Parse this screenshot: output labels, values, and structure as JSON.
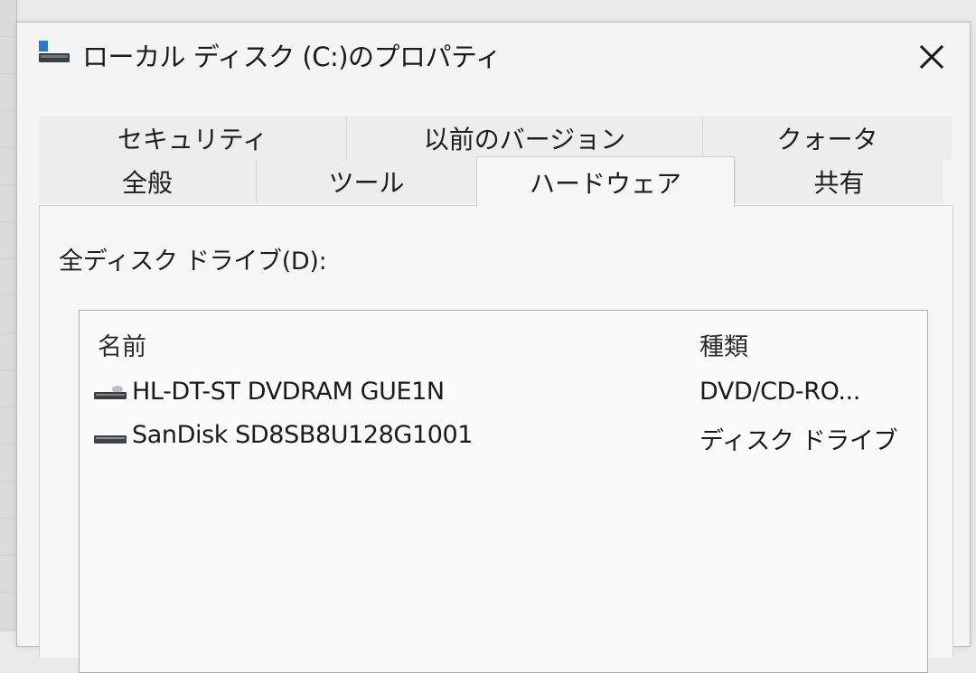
{
  "window": {
    "title": "ローカル ディスク (C:)のプロパティ"
  },
  "tabs": {
    "back_row": [
      "セキュリティ",
      "以前のバージョン",
      "クォータ"
    ],
    "front_row": [
      "全般",
      "ツール",
      "ハードウェア",
      "共有"
    ],
    "active": "ハードウェア"
  },
  "hardware": {
    "section_label": "全ディスク ドライブ(D):",
    "columns": [
      "名前",
      "種類"
    ],
    "devices": [
      {
        "name": "HL-DT-ST DVDRAM GUE1N",
        "type": "DVD/CD-RO...",
        "icon": "optical-drive-icon"
      },
      {
        "name": "SanDisk SD8SB8U128G1001",
        "type": "ディスク ドライブ",
        "icon": "disk-drive-icon"
      }
    ]
  },
  "icons": {
    "title": "drive-icon",
    "close": "close-icon"
  }
}
